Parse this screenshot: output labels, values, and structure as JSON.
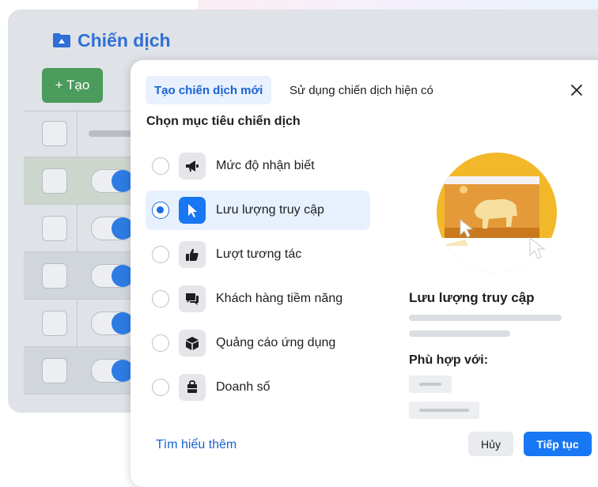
{
  "background": {
    "title": "Chiến dịch",
    "create_button": "+ Tạo",
    "accent": "#2f6fd6",
    "create_color": "#4b9b5c"
  },
  "modal": {
    "tabs": [
      {
        "label": "Tạo chiến dịch mới",
        "active": true
      },
      {
        "label": "Sử dụng chiến dịch hiện có",
        "active": false
      }
    ],
    "heading": "Chọn mục tiêu chiến dịch",
    "objectives": [
      {
        "label": "Mức độ nhận biết",
        "icon": "megaphone-icon",
        "selected": false
      },
      {
        "label": "Lưu lượng truy cập",
        "icon": "cursor-icon",
        "selected": true
      },
      {
        "label": "Lượt tương tác",
        "icon": "thumbs-up-icon",
        "selected": false
      },
      {
        "label": "Khách hàng tiềm năng",
        "icon": "chat-icon",
        "selected": false
      },
      {
        "label": "Quảng cáo ứng dụng",
        "icon": "cube-icon",
        "selected": false
      },
      {
        "label": "Doanh số",
        "icon": "shopping-bag-icon",
        "selected": false
      }
    ],
    "detail": {
      "title": "Lưu lượng truy cập",
      "fit_title": "Phù hợp với:"
    },
    "learn_more": "Tìm hiểu thêm",
    "cancel": "Hủy",
    "continue": "Tiếp tục",
    "primary_color": "#1877f2"
  }
}
